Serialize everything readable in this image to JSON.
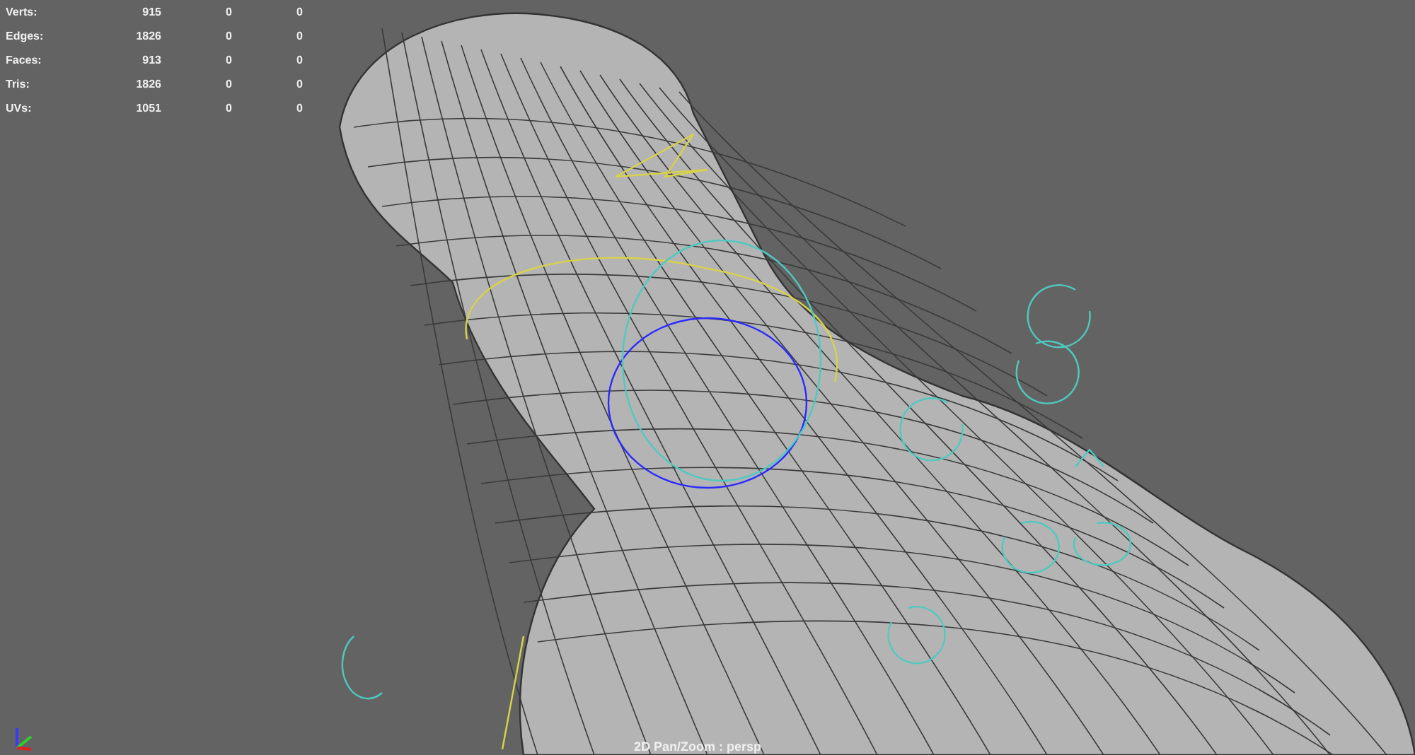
{
  "heads_up_display": {
    "poly_count": [
      {
        "label": "Verts:",
        "values": [
          "915",
          "0",
          "0"
        ]
      },
      {
        "label": "Edges:",
        "values": [
          "1826",
          "0",
          "0"
        ]
      },
      {
        "label": "Faces:",
        "values": [
          "913",
          "0",
          "0"
        ]
      },
      {
        "label": "Tris:",
        "values": [
          "1826",
          "0",
          "0"
        ]
      },
      {
        "label": "UVs:",
        "values": [
          "1051",
          "0",
          "0"
        ]
      }
    ]
  },
  "viewport": {
    "camera_label": "2D Pan/Zoom : persp"
  }
}
